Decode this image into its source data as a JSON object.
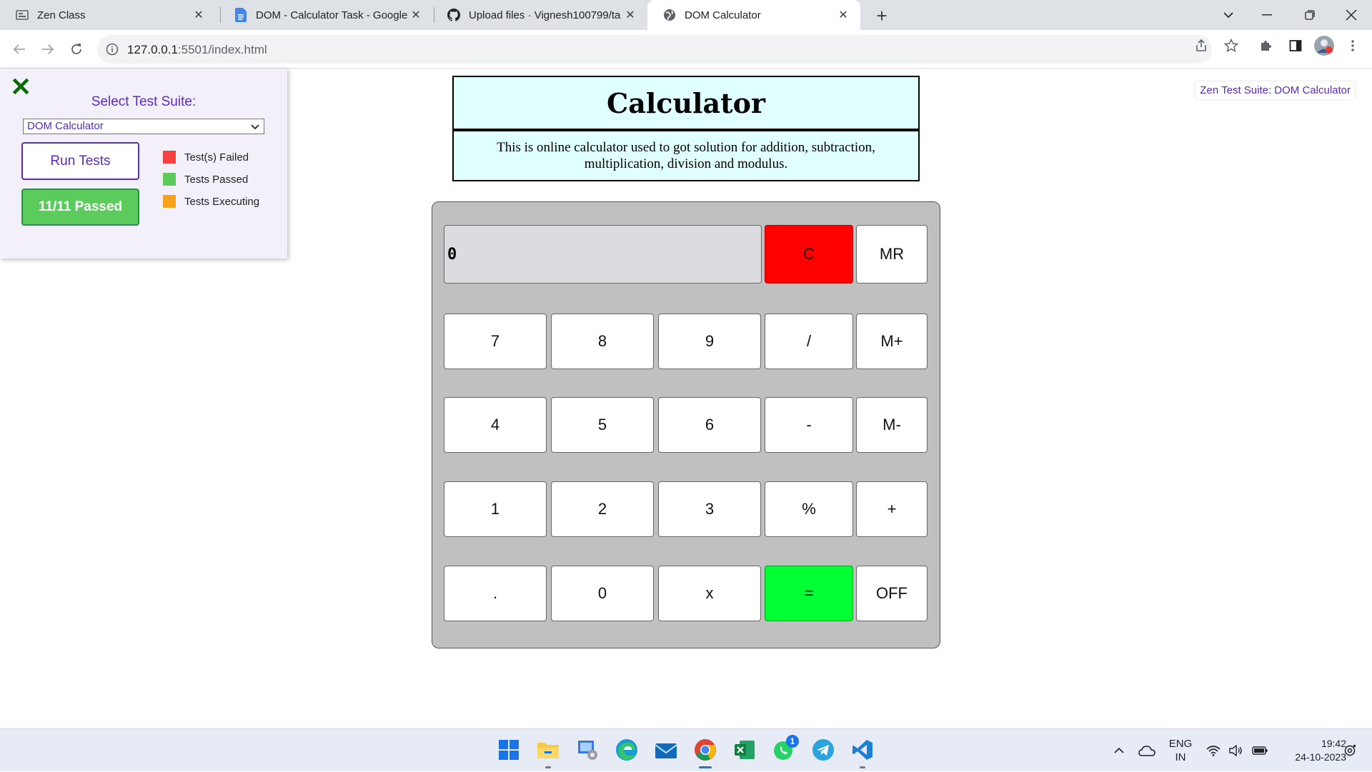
{
  "browser": {
    "tabs": [
      {
        "title": "Zen Class",
        "icon": "zen-class-favicon"
      },
      {
        "title": "DOM - Calculator Task - Google",
        "icon": "google-docs-favicon"
      },
      {
        "title": "Upload files · Vignesh100799/ta",
        "icon": "github-favicon"
      },
      {
        "title": "DOM Calculator",
        "icon": "globe-favicon",
        "active": true
      }
    ],
    "new_tab_label": "+",
    "url_host": "127.0.0.1",
    "url_rest": ":5501/index.html"
  },
  "test_panel": {
    "close_glyph": "✕",
    "select_label": "Select Test Suite:",
    "selected_suite": "DOM Calculator",
    "run_button": "Run Tests",
    "result_button": "11/11 Passed",
    "legend": [
      {
        "label": "Test(s) Failed",
        "color": "#f44242"
      },
      {
        "label": "Tests Passed",
        "color": "#5bcb5b"
      },
      {
        "label": "Tests Executing",
        "color": "#f7a21b"
      }
    ]
  },
  "zen_badge": "Zen Test Suite: DOM Calculator",
  "calculator": {
    "title": "Calculator",
    "description": "This is online calculator used to got solution for addition, subtraction, multiplication, division and modulus.",
    "display_value": "0",
    "keys": {
      "clear": "C",
      "mr": "MR",
      "k7": "7",
      "k8": "8",
      "k9": "9",
      "div": "/",
      "mplus": "M+",
      "k4": "4",
      "k5": "5",
      "k6": "6",
      "sub": "-",
      "mminus": "M-",
      "k1": "1",
      "k2": "2",
      "k3": "3",
      "mod": "%",
      "add": "+",
      "dot": ".",
      "k0": "0",
      "mul": "x",
      "eq": "=",
      "off": "OFF"
    },
    "colors": {
      "clear": "#ff0000",
      "equals": "#00ff33",
      "body": "#c0c0c0",
      "header": "#e0ffff"
    }
  },
  "taskbar": {
    "apps": [
      "windows-start-icon",
      "file-explorer-icon",
      "control-panel-icon",
      "edge-icon",
      "mail-icon",
      "chrome-icon",
      "excel-icon",
      "whatsapp-icon",
      "telegram-icon",
      "vscode-icon"
    ],
    "whatsapp_badge": "1",
    "lang_line1": "ENG",
    "lang_line2": "IN",
    "time": "19:42",
    "date": "24-10-2023"
  }
}
